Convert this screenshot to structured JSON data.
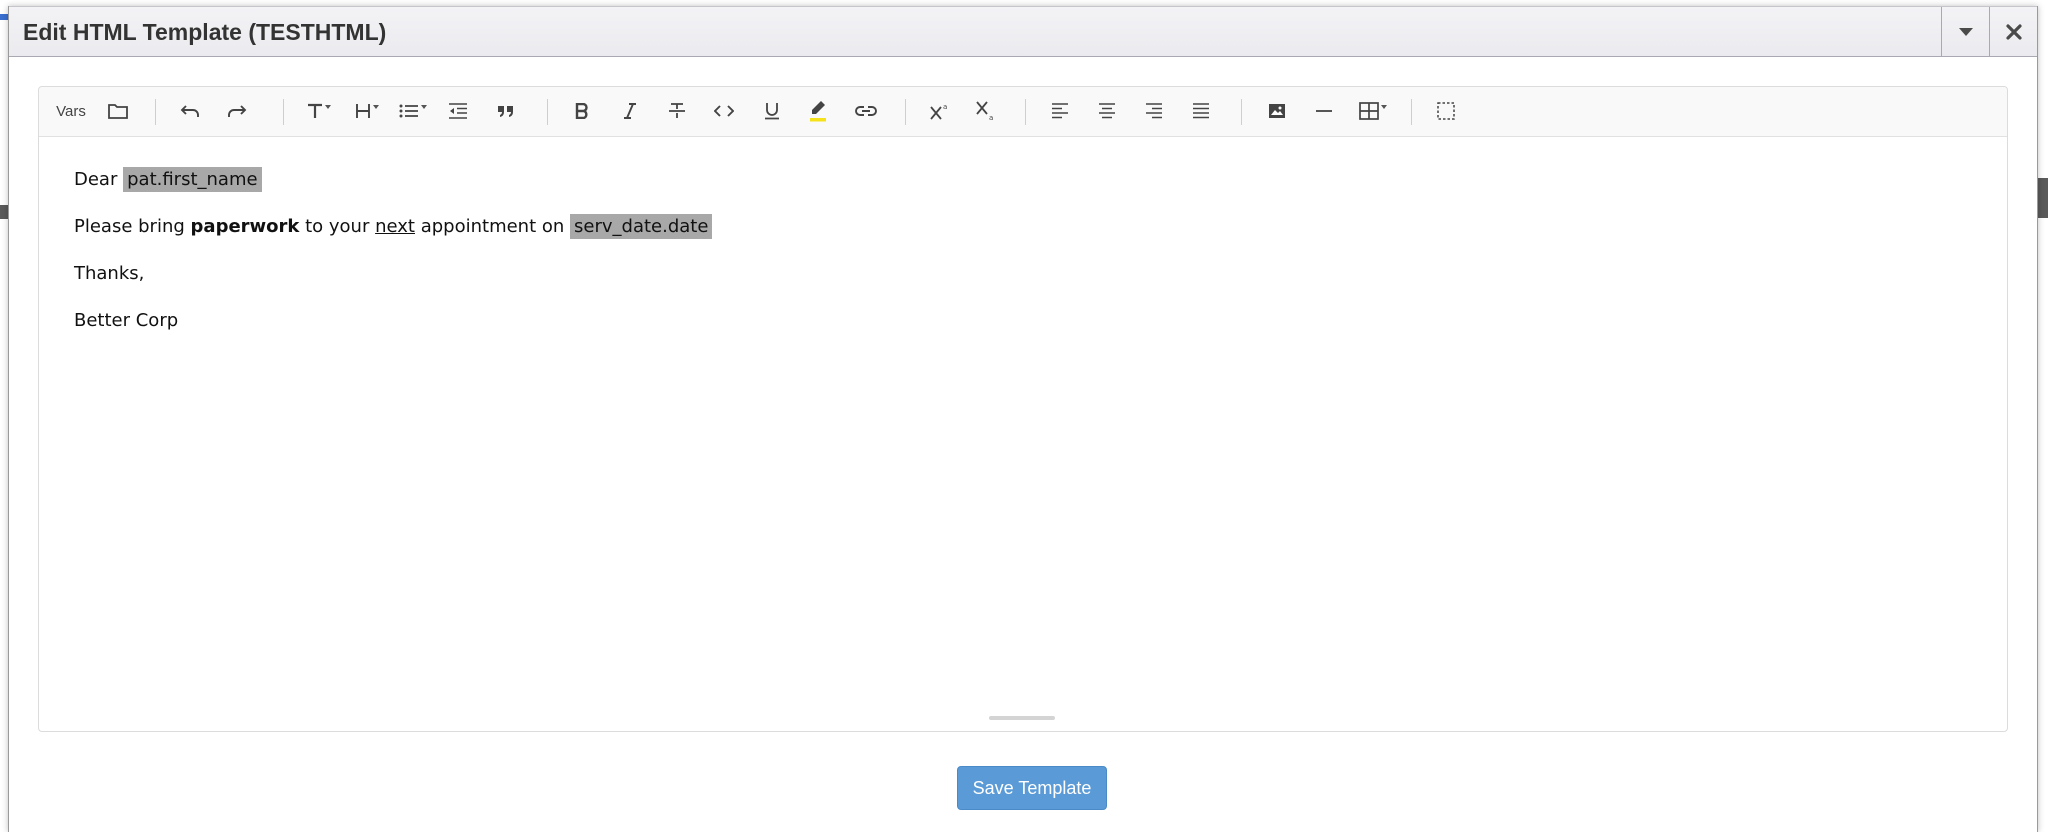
{
  "dialog": {
    "title": "Edit HTML Template (TESTHTML)",
    "collapse_icon": "chevron-down-icon",
    "close_icon": "close-icon"
  },
  "toolbar": {
    "vars_label": "Vars",
    "items": [
      "folder-icon",
      "undo-icon",
      "redo-icon",
      "text-style-icon",
      "heading-icon",
      "list-icon",
      "outdent-icon",
      "blockquote-icon",
      "bold-icon",
      "italic-icon",
      "strikethrough-icon",
      "code-icon",
      "underline-icon",
      "highlight-icon",
      "link-icon",
      "superscript-icon",
      "subscript-icon",
      "align-left-icon",
      "align-center-icon",
      "align-right-icon",
      "align-justify-icon",
      "image-icon",
      "horizontal-rule-icon",
      "table-icon",
      "select-all-icon"
    ],
    "highlight_color": "#f5e21a"
  },
  "content": {
    "line1_prefix": "Dear",
    "line1_var": "pat.first_name",
    "line2_a": "Please bring ",
    "line2_bold": "paperwork",
    "line2_b": " to your ",
    "line2_underline": "next",
    "line2_c": " appointment on ",
    "line2_var": "serv_date.date",
    "line3": "Thanks,",
    "line4": "Better Corp"
  },
  "actions": {
    "save_label": "Save Template"
  },
  "colors": {
    "primary_button": "#5a9ad6",
    "variable_highlight": "#a8a8a8"
  }
}
